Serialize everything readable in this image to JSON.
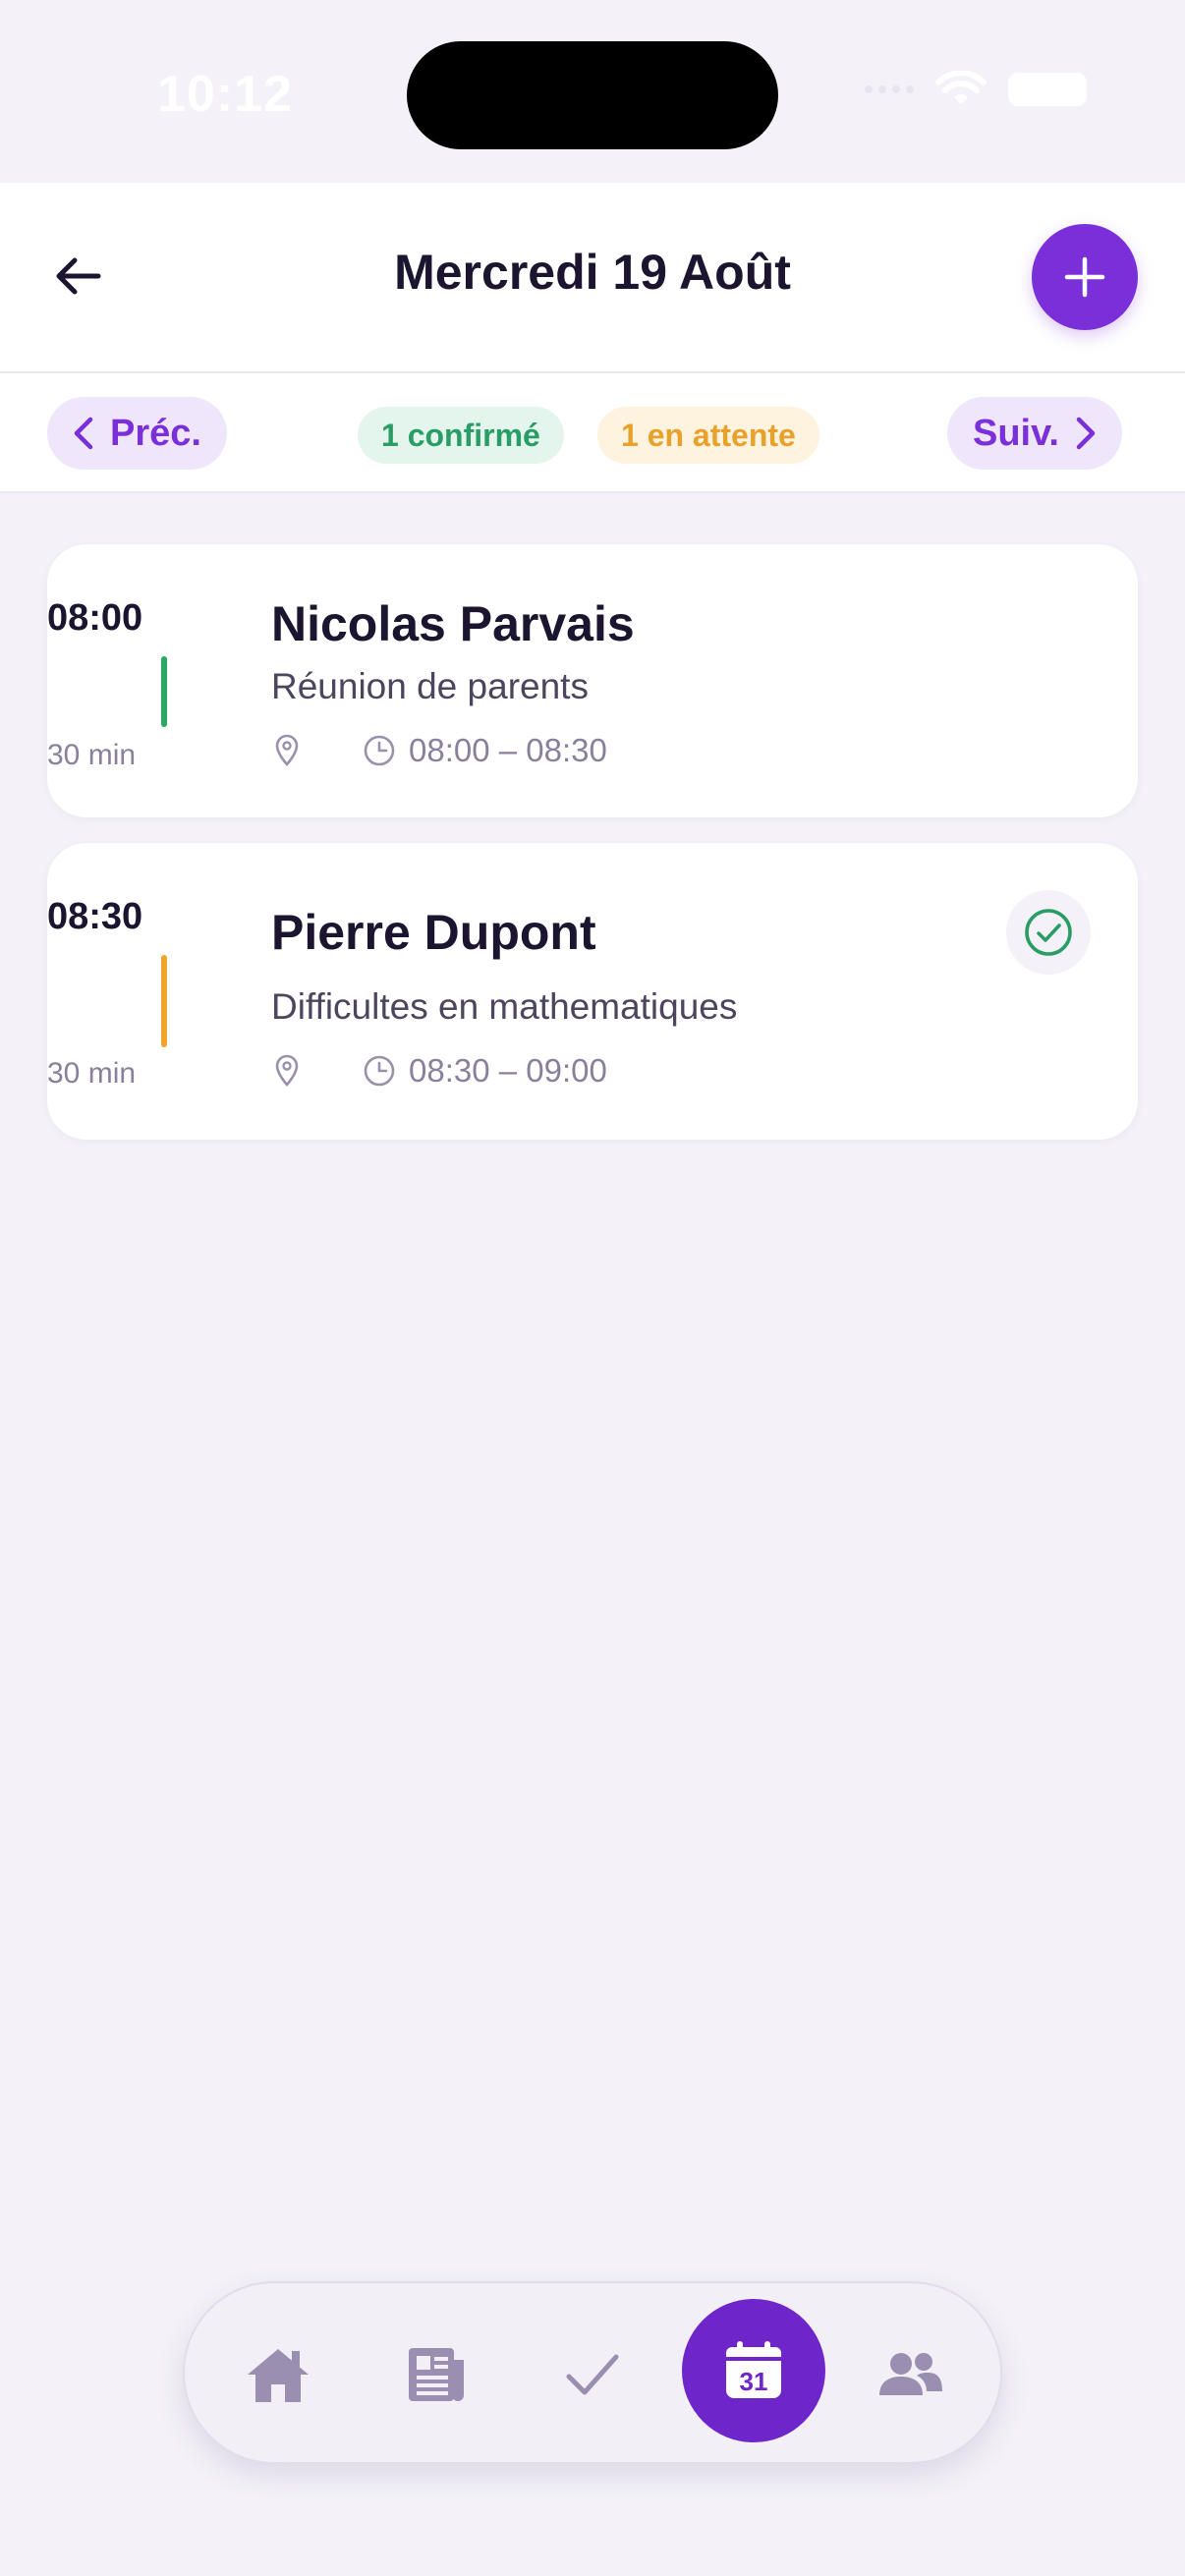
{
  "status_bar": {
    "time": "10:12"
  },
  "header": {
    "title": "Mercredi 19 Août"
  },
  "subnav": {
    "prev_label": "Préc.",
    "next_label": "Suiv.",
    "confirmed_badge": "1 confirmé",
    "pending_badge": "1 en attente"
  },
  "appointments": [
    {
      "start": "08:00",
      "duration": "30 min",
      "name": "Nicolas Parvais",
      "subject": "Réunion de parents",
      "range": "08:00 – 08:30",
      "status_color": "#2aa85f",
      "confirmed": false
    },
    {
      "start": "08:30",
      "duration": "30 min",
      "name": "Pierre Dupont",
      "subject": "Difficultes en mathematiques",
      "range": "08:30 – 09:00",
      "status_color": "#f0a42a",
      "confirmed": true
    }
  ],
  "tabbar": {
    "items": [
      "home-icon",
      "newspaper-icon",
      "check-icon",
      "calendar-icon",
      "people-icon"
    ],
    "active": "calendar-icon",
    "calendar_day": "31"
  },
  "colors": {
    "accent": "#7a2fd8",
    "confirmed": "#2a9d66",
    "pending": "#e8a22c"
  }
}
